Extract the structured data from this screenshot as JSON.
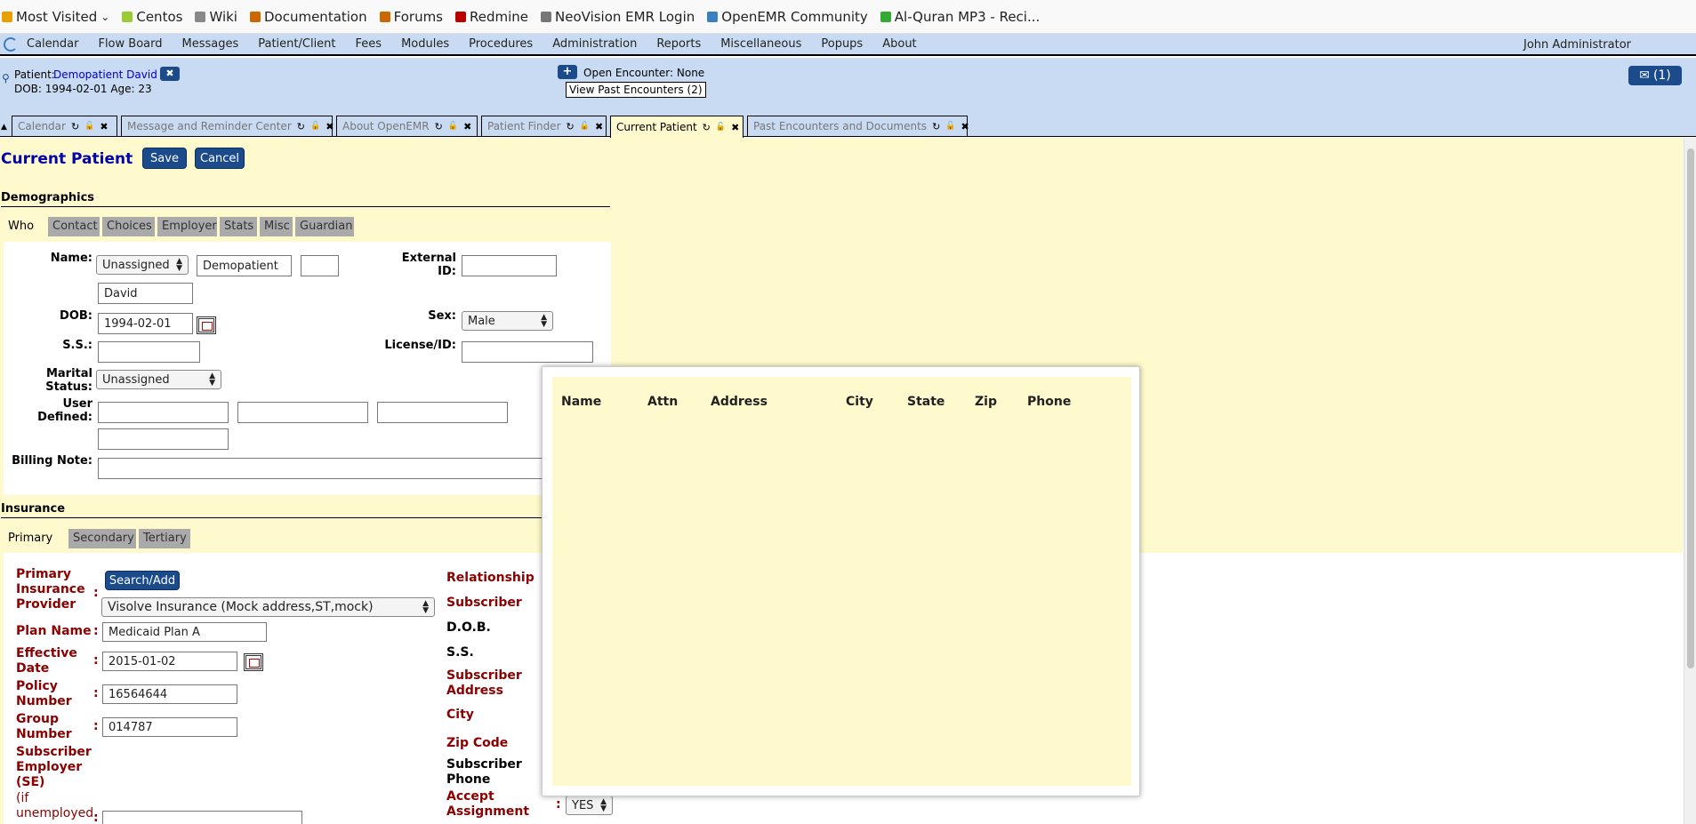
{
  "bookmarks": [
    {
      "label": "Most Visited",
      "icon": "folder-icon",
      "color": "#e8a000"
    },
    {
      "label": "Centos",
      "icon": "centos-icon",
      "color": "#9c3"
    },
    {
      "label": "Wiki",
      "icon": "wiki-icon",
      "color": "#888"
    },
    {
      "label": "Documentation",
      "icon": "doc-icon",
      "color": "#c60"
    },
    {
      "label": "Forums",
      "icon": "forums-icon",
      "color": "#c60"
    },
    {
      "label": "Redmine",
      "icon": "redmine-icon",
      "color": "#b00"
    },
    {
      "label": "NeoVision EMR Login",
      "icon": "globe-icon",
      "color": "#777"
    },
    {
      "label": "OpenEMR Community",
      "icon": "openemr-icon",
      "color": "#3a7fc2"
    },
    {
      "label": "Al-Quran MP3 - Reci...",
      "icon": "quran-icon",
      "color": "#3a3"
    }
  ],
  "nav": {
    "items": [
      "Calendar",
      "Flow Board",
      "Messages",
      "Patient/Client",
      "Fees",
      "Modules",
      "Procedures",
      "Administration",
      "Reports",
      "Miscellaneous",
      "Popups",
      "About"
    ],
    "user": "John Administrator"
  },
  "patient": {
    "label": "Patient:",
    "name": "Demopatient David ()",
    "dob_line": "DOB: 1994-02-01 Age: 23",
    "open_encounter": "Open Encounter: None",
    "past_encounters": "View Past Encounters (2)",
    "messages": "(1)"
  },
  "tabs": [
    {
      "label": "Calendar",
      "active": false
    },
    {
      "label": "Message and Reminder Center",
      "active": false
    },
    {
      "label": "About OpenEMR",
      "active": false
    },
    {
      "label": "Patient Finder",
      "active": false
    },
    {
      "label": "Current Patient",
      "active": true
    },
    {
      "label": "Past Encounters and Documents",
      "active": false
    }
  ],
  "page": {
    "title": "Current Patient",
    "save": "Save",
    "cancel": "Cancel"
  },
  "demographics": {
    "heading": "Demographics",
    "tabs": [
      "Who",
      "Contact",
      "Choices",
      "Employer",
      "Stats",
      "Misc",
      "Guardian"
    ],
    "labels": {
      "name": "Name:",
      "external_id": "External ID:",
      "dob": "DOB:",
      "sex": "Sex:",
      "ss": "S.S.:",
      "license": "License/ID:",
      "marital": "Marital Status:",
      "user_defined": "User Defined:",
      "billing": "Billing Note:"
    },
    "values": {
      "title": "Unassigned",
      "lname": "Demopatient",
      "mname": "",
      "fname": "David",
      "external_id": "",
      "dob": "1994-02-01",
      "sex": "Male",
      "ss": "",
      "license": "",
      "marital": "Unassigned",
      "billing": ""
    }
  },
  "insurance": {
    "heading": "Insurance",
    "tabs": [
      "Primary",
      "Secondary",
      "Tertiary"
    ],
    "labels": {
      "provider": "Primary Insurance Provider",
      "plan": "Plan Name",
      "effective": "Effective Date",
      "policy": "Policy Number",
      "group": "Group Number",
      "employer": "Subscriber Employer (SE)",
      "employer_note": "(if unemployed",
      "relationship": "Relationship",
      "subscriber": "Subscriber",
      "sub_dob": "D.O.B.",
      "sub_ss": "S.S.",
      "sub_address": "Subscriber Address",
      "city": "City",
      "zip": "Zip Code",
      "sub_phone": "Subscriber Phone",
      "accept": "Accept Assignment"
    },
    "search_button": "Search/Add",
    "values": {
      "provider": "Visolve Insurance (Mock address,ST,mock)",
      "plan": "Medicaid Plan A",
      "effective": "2015-01-02",
      "policy": "16564644",
      "group": "014787",
      "accept": "YES"
    }
  },
  "popup": {
    "columns": [
      "Name",
      "Attn",
      "Address",
      "City",
      "State",
      "Zip",
      "Phone"
    ]
  }
}
